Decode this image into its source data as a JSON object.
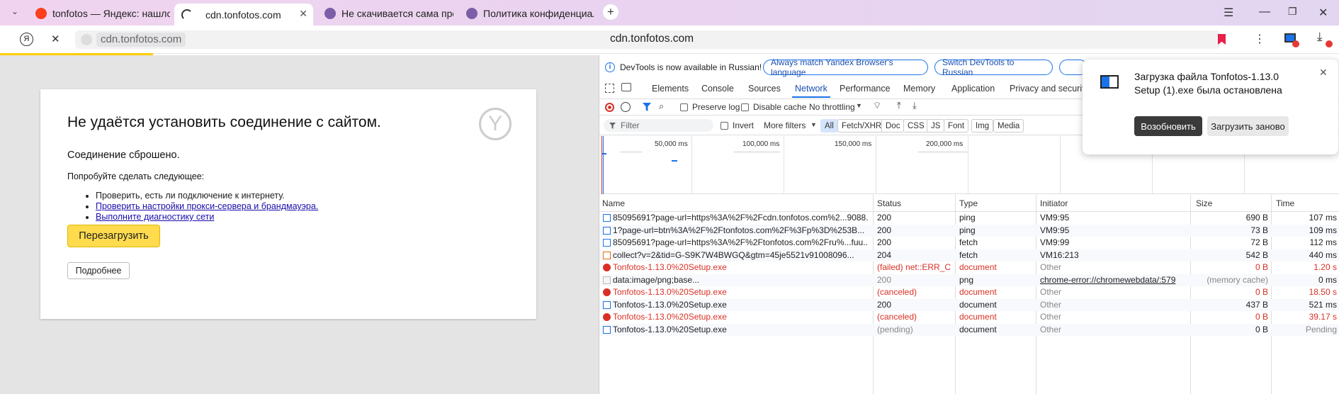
{
  "tabs": [
    {
      "title": "tonfotos — Яндекс: нашлось",
      "icon": "yandex-icon"
    },
    {
      "title": "cdn.tonfotos.com",
      "icon": "loading-spinner-icon",
      "active": true
    },
    {
      "title": "Не скачивается сама прог",
      "icon": "site-icon"
    },
    {
      "title": "Политика конфиденциаль",
      "icon": "site-icon"
    }
  ],
  "address": {
    "url_chip": "cdn.tonfotos.com",
    "title": "cdn.tonfotos.com"
  },
  "error_page": {
    "heading": "Не удаётся установить соединение с сайтом.",
    "reason": "Соединение сброшено.",
    "try_label": "Попробуйте сделать следующее:",
    "suggestions": [
      "Проверить, есть ли подключение к интернету.",
      "Проверить настройки прокси-сервера и брандмауэра.",
      "Выполните диагностику сети"
    ],
    "reload_button": "Перезагрузить",
    "details_button": "Подробнее"
  },
  "devtools": {
    "info_text": "DevTools is now available in Russian!",
    "match_button": "Always match Yandex Browser's language",
    "switch_button": "Switch DevTools to Russian",
    "panels": [
      "Elements",
      "Console",
      "Sources",
      "Network",
      "Performance",
      "Memory",
      "Application",
      "Privacy and security"
    ],
    "active_panel": "Network",
    "toolbar": {
      "preserve_log": "Preserve log",
      "disable_cache": "Disable cache",
      "throttling": "No throttling"
    },
    "filter": {
      "placeholder": "Filter",
      "invert": "Invert",
      "more_filters": "More filters",
      "types": [
        "All",
        "Fetch/XHR",
        "Doc",
        "CSS",
        "JS",
        "Font",
        "Img",
        "Media"
      ]
    },
    "timeline_labels": [
      "50,000 ms",
      "100,000 ms",
      "150,000 ms",
      "200,000 ms"
    ],
    "columns": [
      "Name",
      "Status",
      "Type",
      "Initiator",
      "Size",
      "Time"
    ],
    "rows": [
      {
        "name": "85095691?page-url=https%3A%2F%2Fcdn.tonfotos.com%2...9088...",
        "status": "200",
        "type": "ping",
        "initiator": "VM9:95",
        "size": "690 B",
        "time": "107 ms",
        "state": "ok",
        "icon": "document-icon"
      },
      {
        "name": "1?page-url=btn%3A%2F%2Ftonfotos.com%2F%3Fp%3D%253B...",
        "status": "200",
        "type": "ping",
        "initiator": "VM9:95",
        "size": "73 B",
        "time": "109 ms",
        "state": "ok",
        "icon": "document-icon"
      },
      {
        "name": "85095691?page-url=https%3A%2F%2Ftonfotos.com%2Fru%...fuu...",
        "status": "200",
        "type": "fetch",
        "initiator": "VM9:99",
        "size": "72 B",
        "time": "112 ms",
        "state": "ok",
        "icon": "document-icon"
      },
      {
        "name": "collect?v=2&tid=G-S9K7W4BWGQ&gtm=45je5521v91008096...",
        "status": "204",
        "type": "fetch",
        "initiator": "VM16:213",
        "size": "542 B",
        "time": "440 ms",
        "state": "ok",
        "icon": "fetch-icon"
      },
      {
        "name": "Tonfotos-1.13.0%20Setup.exe",
        "status": "(failed) net::ERR_C...",
        "type": "document",
        "initiator": "Other",
        "size": "0 B",
        "time": "1.20 s",
        "state": "error",
        "icon": "error-icon"
      },
      {
        "name": "data:image/png;base...",
        "status": "200",
        "type": "png",
        "initiator": "chrome-error://chromewebdata/:579",
        "size": "(memory cache)",
        "time": "0 ms",
        "state": "cached",
        "icon": "image-icon"
      },
      {
        "name": "Tonfotos-1.13.0%20Setup.exe",
        "status": "(canceled)",
        "type": "document",
        "initiator": "Other",
        "size": "0 B",
        "time": "18.50 s",
        "state": "error",
        "icon": "error-icon"
      },
      {
        "name": "Tonfotos-1.13.0%20Setup.exe",
        "status": "200",
        "type": "document",
        "initiator": "Other",
        "size": "437 B",
        "time": "521 ms",
        "state": "ok",
        "icon": "document-icon"
      },
      {
        "name": "Tonfotos-1.13.0%20Setup.exe",
        "status": "(canceled)",
        "type": "document",
        "initiator": "Other",
        "size": "0 B",
        "time": "39.17 s",
        "state": "error",
        "icon": "error-icon"
      },
      {
        "name": "Tonfotos-1.13.0%20Setup.exe",
        "status": "(pending)",
        "type": "document",
        "initiator": "Other",
        "size": "0 B",
        "time": "Pending",
        "state": "pending",
        "icon": "document-icon"
      }
    ]
  },
  "download_popup": {
    "message": "Загрузка файла Tonfotos-1.13.0 Setup (1).exe была остановлена",
    "resume_button": "Возобновить",
    "retry_button": "Загрузить заново"
  },
  "colors": {
    "accent": "#1a73e8",
    "error": "#d93025",
    "reload_button": "#ffdb4d",
    "tabstrip": "#ecd5f0"
  }
}
